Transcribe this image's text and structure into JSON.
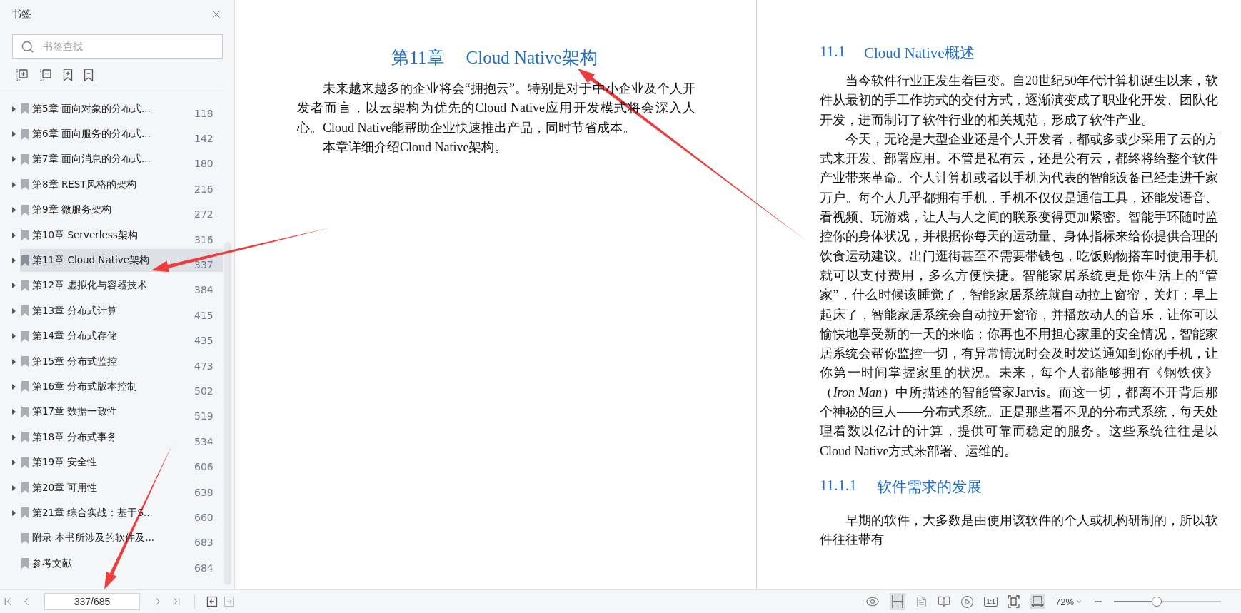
{
  "sidebar": {
    "title": "书签",
    "search": {
      "placeholder": "书签查找"
    },
    "bookmarks": [
      {
        "label": "第5章 面向对象的分布式...",
        "page": "118",
        "expandable": true,
        "selected": false
      },
      {
        "label": "第6章 面向服务的分布式...",
        "page": "142",
        "expandable": true,
        "selected": false
      },
      {
        "label": "第7章 面向消息的分布式...",
        "page": "180",
        "expandable": true,
        "selected": false
      },
      {
        "label": "第8章 REST风格的架构",
        "page": "216",
        "expandable": true,
        "selected": false
      },
      {
        "label": "第9章 微服务架构",
        "page": "272",
        "expandable": true,
        "selected": false
      },
      {
        "label": "第10章 Serverless架构",
        "page": "316",
        "expandable": true,
        "selected": false
      },
      {
        "label": "第11章 Cloud Native架构",
        "page": "337",
        "expandable": true,
        "selected": true
      },
      {
        "label": "第12章 虚拟化与容器技术",
        "page": "384",
        "expandable": true,
        "selected": false
      },
      {
        "label": "第13章 分布式计算",
        "page": "415",
        "expandable": true,
        "selected": false
      },
      {
        "label": "第14章 分布式存储",
        "page": "435",
        "expandable": true,
        "selected": false
      },
      {
        "label": "第15章 分布式监控",
        "page": "473",
        "expandable": true,
        "selected": false
      },
      {
        "label": "第16章 分布式版本控制",
        "page": "502",
        "expandable": true,
        "selected": false
      },
      {
        "label": "第17章 数据一致性",
        "page": "519",
        "expandable": true,
        "selected": false
      },
      {
        "label": "第18章 分布式事务",
        "page": "534",
        "expandable": true,
        "selected": false
      },
      {
        "label": "第19章 安全性",
        "page": "606",
        "expandable": true,
        "selected": false
      },
      {
        "label": "第20章 可用性",
        "page": "638",
        "expandable": true,
        "selected": false
      },
      {
        "label": "第21章 综合实战：基于S...",
        "page": "660",
        "expandable": true,
        "selected": false
      },
      {
        "label": "附录 本书所涉及的软件及...",
        "page": "683",
        "expandable": false,
        "selected": false
      },
      {
        "label": "参考文献",
        "page": "684",
        "expandable": false,
        "selected": false
      }
    ]
  },
  "left_page": {
    "heading": {
      "number": "第11章",
      "title": "Cloud Native架构"
    },
    "paragraphs": [
      "未来越来越多的企业将会“拥抱云”。特别是对于中小企业及个人开发者而言，以云架构为优先的Cloud Native应用开发模式将会深入人心。Cloud Native能帮助企业快速推出产品，同时节省成本。",
      "本章详细介绍Cloud Native架构。"
    ]
  },
  "right_page": {
    "blocks": [
      {
        "kind": "section",
        "number": "11.1",
        "title": "Cloud Native概述"
      },
      {
        "kind": "paragraph",
        "text": "当今软件行业正发生着巨变。自20世纪50年代计算机诞生以来，软件从最初的手工作坊式的交付方式，逐渐演变成了职业化开发、团队化开发，进而制订了软件行业的相关规范，形成了软件产业。"
      },
      {
        "kind": "paragraph",
        "text": "今天，无论是大型企业还是个人开发者，都或多或少采用了云的方式来开发、部署应用。不管是私有云，还是公有云，都终将给整个软件产业带来革命。个人计算机或者以手机为代表的智能设备已经走进千家万户。每个人几乎都拥有手机，手机不仅仅是通信工具，还能发语音、看视频、玩游戏，让人与人之间的联系变得更加紧密。智能手环随时监控你的身体状况，并根据你每天的运动量、身体指标来给你提供合理的饮食运动建议。出门逛街甚至不需要带钱包，吃饭购物搭车时使用手机就可以支付费用，多么方便快捷。智能家居系统更是你生活上的“管家”，什么时候该睡觉了，智能家居系统就自动拉上窗帘，关灯；早上起床了，智能家居系统会自动拉开窗帘，并播放动人的音乐，让你可以愉快地享受新的一天的来临；你再也不用担心家里的安全情况，智能家居系统会帮你监控一切，有异常情况时会及时发送通知到你的手机，让你第一时间掌握家里的状况。未来，每个人都能够拥有《钢铁侠》（*Iron Man*）中所描述的智能管家Jarvis。而这一切，都离不开背后那个神秘的巨人——分布式系统。正是那些看不见的分布式系统，每天处理着数以亿计的计算，提供可靠而稳定的服务。这些系统往往是以Cloud Native方式来部署、运维的。"
      },
      {
        "kind": "subsection",
        "number": "11.1.1",
        "title": "软件需求的发展"
      },
      {
        "kind": "paragraph",
        "text": "早期的软件，大多数是由使用该软件的个人或机构研制的，所以软件往往带有"
      }
    ]
  },
  "status_bar": {
    "page_field": "337/685",
    "actual_size": "1:1",
    "zoom": "72%",
    "zoom_slider": {
      "level": 0.4
    }
  }
}
